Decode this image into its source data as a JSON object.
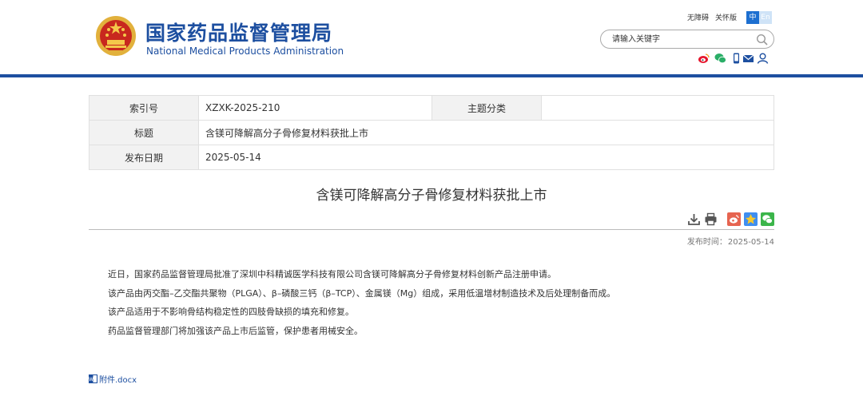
{
  "header": {
    "title_cn": "国家药品监督管理局",
    "title_en": "National Medical Products Administration",
    "links": [
      "无障碍",
      "关怀版"
    ],
    "lang_zh": "中",
    "lang_en": "En",
    "search_placeholder": "请输入关键字",
    "brand_color": "#1d4fa0"
  },
  "share_icons": [
    "weibo-icon",
    "wechat-icon",
    "mobile-icon",
    "mail-icon",
    "user-icon"
  ],
  "meta": {
    "index_label": "索引号",
    "index_value": "XZXK-2025-210",
    "category_label": "主题分类",
    "category_value": "",
    "title_label": "标题",
    "title_value": "含镁可降解高分子骨修复材料获批上市",
    "date_label": "发布日期",
    "date_value": "2025-05-14"
  },
  "article": {
    "title": "含镁可降解高分子骨修复材料获批上市",
    "pubdate_label": "发布时间：",
    "pubdate_value": "2025-05-14",
    "paragraphs": [
      "近日，国家药品监督管理局批准了深圳中科精诚医学科技有限公司含镁可降解高分子骨修复材料创新产品注册申请。",
      "该产品由丙交酯–乙交酯共聚物（PLGA）、β–磷酸三钙（β–TCP）、金属镁（Mg）组成，采用低温增材制造技术及后处理制备而成。",
      "该产品适用于不影响骨结构稳定性的四肢骨缺损的填充和修复。",
      "药品监督管理部门将加强该产品上市后监管，保护患者用械安全。"
    ],
    "attachment": "附件.docx"
  },
  "tool_icons": [
    "download-icon",
    "print-icon",
    "weibo-share-icon",
    "qzone-share-icon",
    "wechat-share-icon"
  ]
}
